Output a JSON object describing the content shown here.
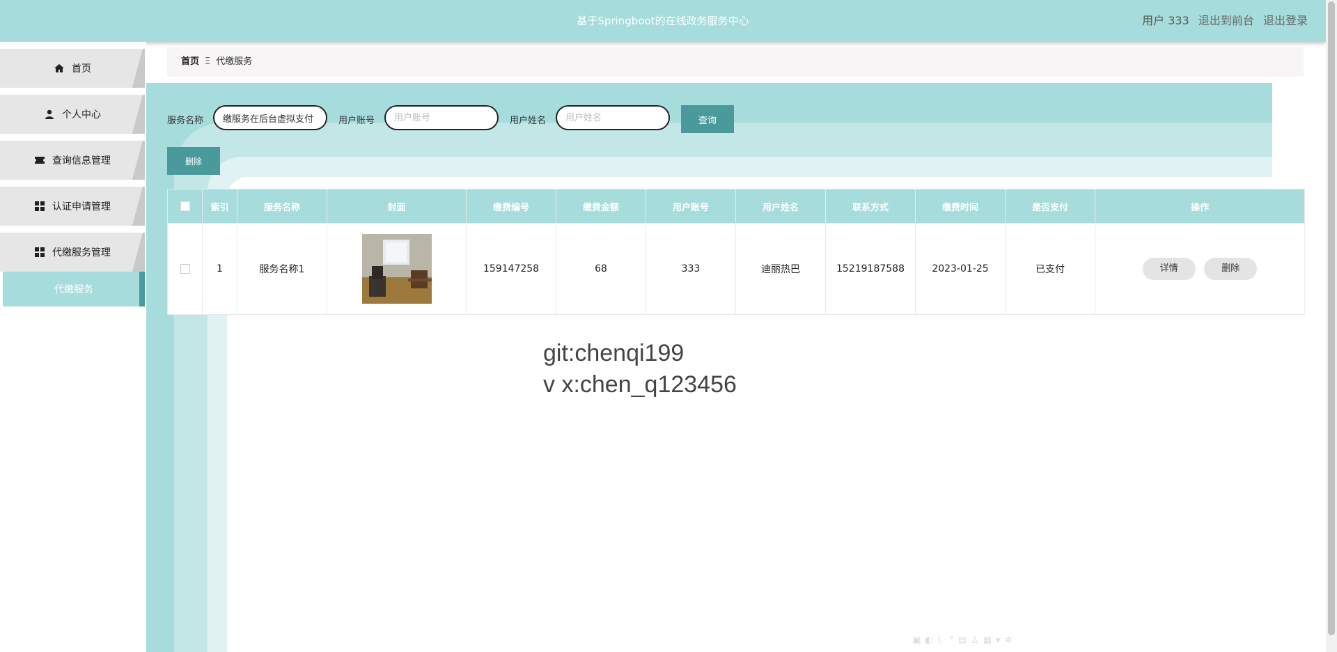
{
  "header": {
    "title": "基于Springboot的在线政务服务中心",
    "user": "用户 333",
    "to_front": "退出到前台",
    "logout": "退出登录"
  },
  "sidebar": {
    "items": [
      {
        "label": "首页",
        "icon": "home-icon"
      },
      {
        "label": "个人中心",
        "icon": "user-icon"
      },
      {
        "label": "查询信息管理",
        "icon": "ticket-icon"
      },
      {
        "label": "认证申请管理",
        "icon": "grid-icon"
      },
      {
        "label": "代缴服务管理",
        "icon": "grid-icon"
      }
    ],
    "sub_item": "代缴服务"
  },
  "breadcrumb": {
    "home": "首页",
    "separator": "Ξ",
    "current": "代缴服务"
  },
  "search": {
    "service_label": "服务名称",
    "service_value": "缴服务在后台虚拟支付",
    "account_label": "用户账号",
    "account_placeholder": "用户账号",
    "name_label": "用户姓名",
    "name_placeholder": "用户姓名",
    "query_button": "查询"
  },
  "actions": {
    "delete_button": "删除"
  },
  "table": {
    "headers": [
      "索引",
      "服务名称",
      "封面",
      "缴费编号",
      "缴费金额",
      "用户账号",
      "用户姓名",
      "联系方式",
      "缴费时间",
      "是否支付",
      "操作"
    ],
    "rows": [
      {
        "index": "1",
        "service_name": "服务名称1",
        "pay_no": "159147258",
        "amount": "68",
        "account": "333",
        "name": "迪丽热巴",
        "phone": "15219187588",
        "pay_time": "2023-01-25",
        "paid": "已支付",
        "detail_btn": "详情",
        "delete_btn": "删除"
      }
    ]
  },
  "watermark": {
    "line1": "git:chenqi199",
    "line2": "v x:chen_q123456"
  },
  "colors": {
    "theme": "#a6dcdc",
    "accent": "#4a9a9c"
  }
}
